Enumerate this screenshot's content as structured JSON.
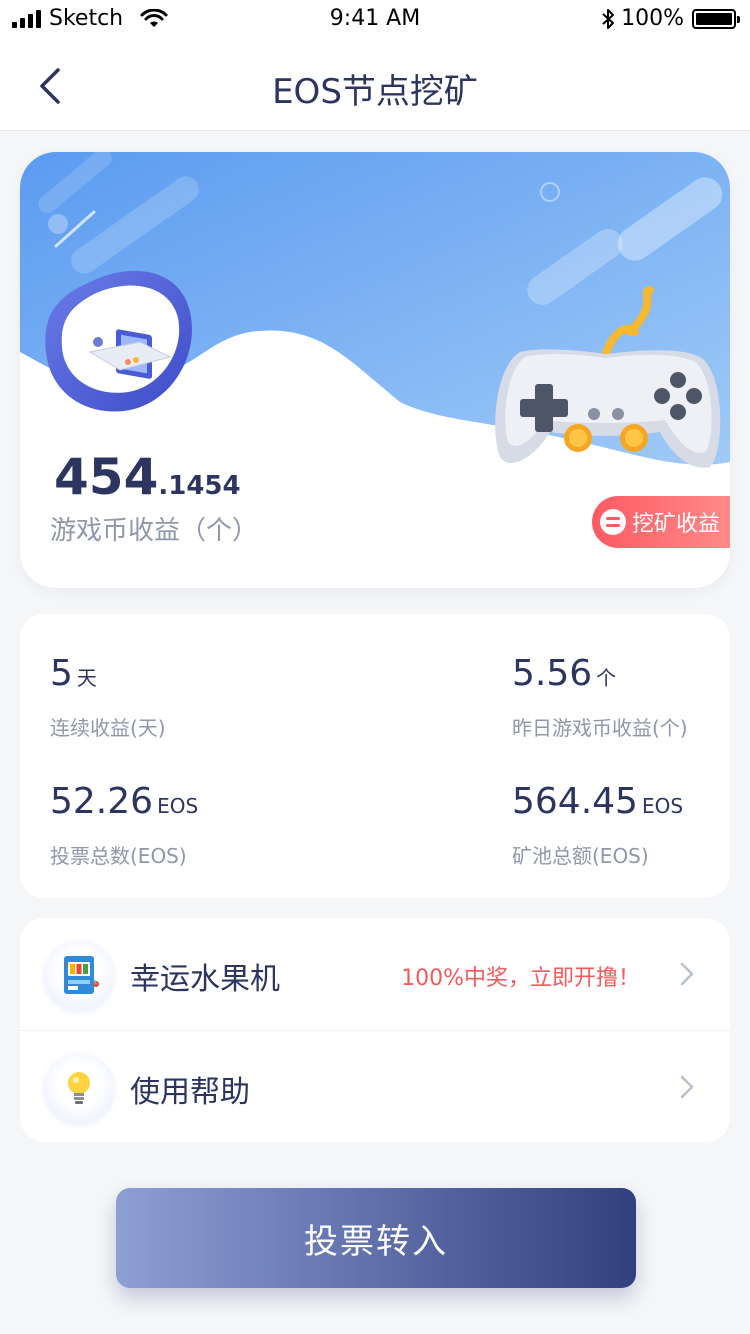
{
  "status_bar": {
    "carrier": "Sketch",
    "time": "9:41 AM",
    "battery": "100%"
  },
  "nav": {
    "title": "EOS节点挖矿"
  },
  "hero": {
    "amount_int": "454",
    "amount_dec": ".1454",
    "label": "游戏币收益（个）",
    "mining_button": "挖矿收益"
  },
  "stats": {
    "streak": {
      "value": "5",
      "unit": "天",
      "label": "连续收益(天)"
    },
    "yesterday": {
      "value": "5.56",
      "unit": "个",
      "label": "昨日游戏币收益(个)"
    },
    "votes": {
      "value": "52.26",
      "unit": "EOS",
      "label": "投票总数(EOS)"
    },
    "pool": {
      "value": "564.45",
      "unit": "EOS",
      "label": "矿池总额(EOS)"
    }
  },
  "menu": {
    "items": [
      {
        "label": "幸运水果机",
        "promo": "100%中奖，立即开撸！",
        "icon": "slot-machine-icon"
      },
      {
        "label": "使用帮助",
        "promo": "",
        "icon": "lightbulb-icon"
      }
    ]
  },
  "cta": {
    "label": "投票转入"
  },
  "colors": {
    "primary_text": "#2b3560",
    "secondary_text": "#9097a8",
    "promo": "#f45a5a",
    "cta_start": "#8d9fd4",
    "cta_end": "#324080"
  }
}
